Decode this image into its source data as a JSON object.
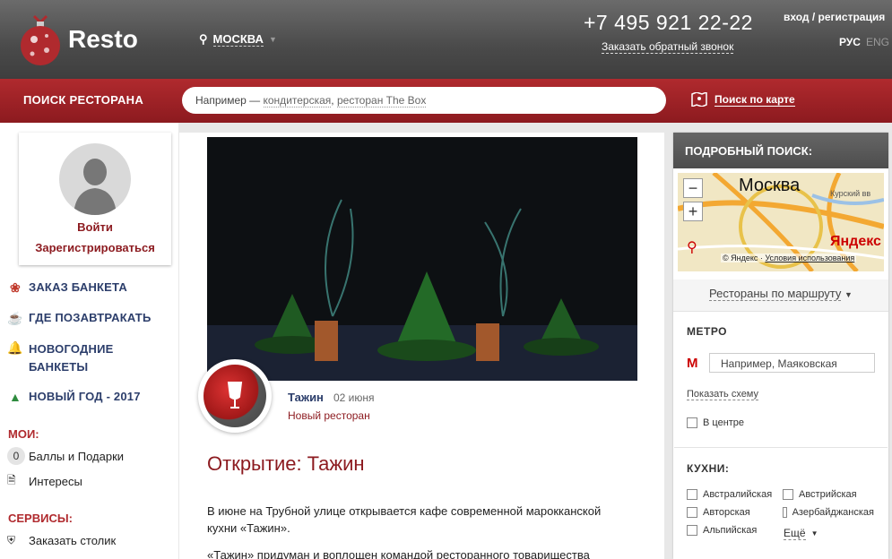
{
  "header": {
    "logo_text": "Resto",
    "city": "МОСКВА",
    "phone": "+7 495  921 22-22",
    "callback": "Заказать обратный звонок",
    "login_register": "вход / регистрация",
    "lang_ru": "РУС",
    "lang_en": "ENG"
  },
  "searchbar": {
    "label": "ПОИСК РЕСТОРАНА",
    "placeholder_prefix": "Например —",
    "example1": "кондитерская",
    "example2": "ресторан The Box",
    "map_link": "Поиск по карте"
  },
  "profile": {
    "login": "Войти",
    "register": "Зарегистрироваться"
  },
  "nav": [
    {
      "label": "ЗАКАЗ БАНКЕТА",
      "icon": "bow-icon"
    },
    {
      "label": "ГДЕ ПОЗАВТРАКАТЬ",
      "icon": "coffee-cup-icon"
    },
    {
      "label": "НОВОГОДНИЕ",
      "label2": "БАНКЕТЫ",
      "icon": "bells-icon"
    },
    {
      "label": "НОВЫЙ ГОД - 2017",
      "icon": "tree-icon"
    }
  ],
  "my": {
    "heading": "МОИ:",
    "points_count": "0",
    "points_label": "Баллы и Подарки",
    "interests": "Интересы"
  },
  "services": {
    "heading": "СЕРВИСЫ:",
    "book_table": "Заказать столик"
  },
  "article": {
    "restaurant_name": "Тажин",
    "date": "02 июня",
    "tag": "Новый ресторан",
    "title": "Открытие: Тажин",
    "para1": "В июне на Трубной улице открывается кафе современной марокканской кухни «Тажин».",
    "para2": "«Тажин» придуман и воплощен командой ресторанного товарищества"
  },
  "filters": {
    "heading": "ПОДРОБНЫЙ ПОИСК:",
    "map_city": "Москва",
    "map_yandex": "Яндекс",
    "map_copyright": "© Яндекс",
    "map_terms": "Условия использования",
    "map_district": "Курский вв",
    "route": "Рестораны по маршруту",
    "metro_label": "МЕТРО",
    "metro_placeholder": "Например, Маяковская",
    "show_scheme": "Показать схему",
    "center": "В центре",
    "cuisine_label": "КУХНИ:",
    "cuisines": [
      "Австралийская",
      "Австрийская",
      "Авторская",
      "Азербайджанская",
      "Альпийская"
    ],
    "more": "Ещё"
  },
  "colors": {
    "brand_red": "#8c1a1f",
    "nav_blue": "#2c3e6b"
  }
}
